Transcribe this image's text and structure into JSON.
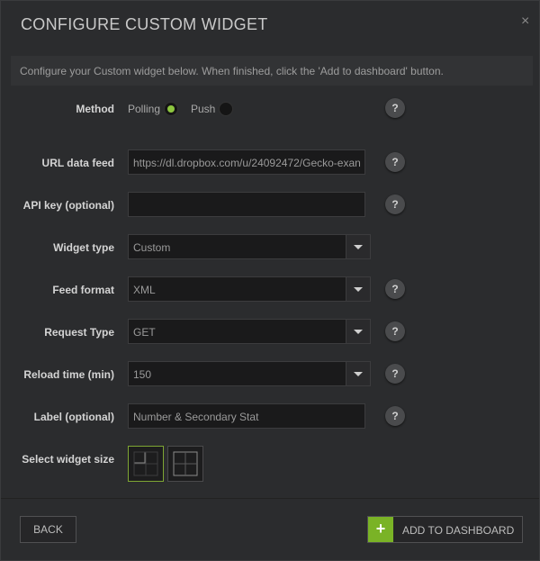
{
  "dialog": {
    "title": "CONFIGURE CUSTOM WIDGET",
    "close_glyph": "×",
    "info": "Configure your Custom widget below. When finished, click the 'Add to dashboard' button."
  },
  "method": {
    "label": "Method",
    "options": [
      "Polling",
      "Push"
    ],
    "selected": "Polling"
  },
  "url_feed": {
    "label": "URL data feed",
    "value": "https://dl.dropbox.com/u/24092472/Gecko-exan"
  },
  "api_key": {
    "label": "API key (optional)",
    "value": ""
  },
  "widget_type": {
    "label": "Widget type",
    "value": "Custom"
  },
  "feed_format": {
    "label": "Feed format",
    "value": "XML"
  },
  "request_type": {
    "label": "Request Type",
    "value": "GET"
  },
  "reload_time": {
    "label": "Reload time (min)",
    "value": "150"
  },
  "label_field": {
    "label": "Label (optional)",
    "value": "Number & Secondary Stat"
  },
  "widget_size": {
    "label": "Select widget size",
    "options": [
      "1x1",
      "2x2"
    ],
    "selected": "1x1"
  },
  "help_glyph": "?",
  "buttons": {
    "back": "BACK",
    "add": "ADD TO DASHBOARD",
    "add_icon": "+"
  },
  "colors": {
    "accent": "#7ab326",
    "background": "#2b2c2e",
    "field": "#1a1a1b"
  }
}
